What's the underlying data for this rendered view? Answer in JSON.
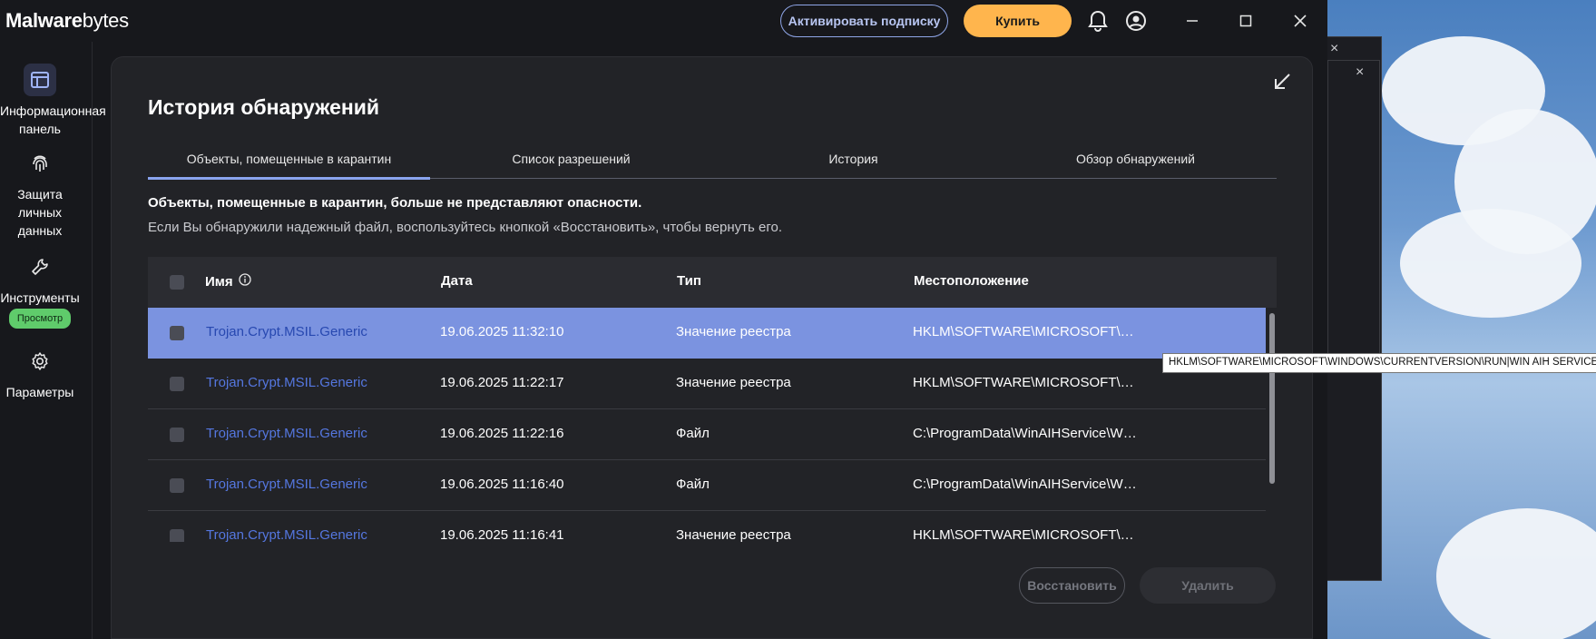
{
  "app": {
    "brand_bold": "Malware",
    "brand_thin": "bytes"
  },
  "titlebar": {
    "activate_label": "Активировать подписку",
    "buy_label": "Купить"
  },
  "sidebar": {
    "items": [
      {
        "label": "Информационная панель",
        "icon": "dashboard-icon"
      },
      {
        "label": "Защита личных данных",
        "icon": "fingerprint-icon"
      },
      {
        "label": "Инструменты",
        "icon": "wrench-icon",
        "badge": "Просмотр"
      },
      {
        "label": "Параметры",
        "icon": "gear-icon"
      }
    ]
  },
  "panel": {
    "title": "История обнаружений",
    "tabs": [
      "Объекты, помещенные в карантин",
      "Список разрешений",
      "История",
      "Обзор обнаружений"
    ],
    "info_bold": "Объекты, помещенные в карантин, больше не представляют опасности.",
    "info_text": "Если Вы обнаружили надежный файл, воспользуйтесь кнопкой «Восстановить», чтобы вернуть его.",
    "columns": {
      "name": "Имя",
      "date": "Дата",
      "type": "Тип",
      "location": "Местоположение"
    },
    "rows": [
      {
        "name": "Trojan.Crypt.MSIL.Generic",
        "date": "19.06.2025 11:32:10",
        "type": "Значение реестра",
        "location": "HKLM\\SOFTWARE\\MICROSOFT\\WIN..."
      },
      {
        "name": "Trojan.Crypt.MSIL.Generic",
        "date": "19.06.2025 11:22:17",
        "type": "Значение реестра",
        "location": "HKLM\\SOFTWARE\\MICROSOFT\\WIN..."
      },
      {
        "name": "Trojan.Crypt.MSIL.Generic",
        "date": "19.06.2025 11:22:16",
        "type": "Файл",
        "location": "C:\\ProgramData\\WinAIHService\\Win..."
      },
      {
        "name": "Trojan.Crypt.MSIL.Generic",
        "date": "19.06.2025 11:16:40",
        "type": "Файл",
        "location": "C:\\ProgramData\\WinAIHService\\Win..."
      },
      {
        "name": "Trojan.Crypt.MSIL.Generic",
        "date": "19.06.2025 11:16:41",
        "type": "Значение реестра",
        "location": "HKLM\\SOFTWARE\\MICROSOFT\\WIN..."
      }
    ],
    "restore_label": "Восстановить",
    "delete_label": "Удалить"
  },
  "tooltip": "HKLM\\SOFTWARE\\MICROSOFT\\WINDOWS\\CURRENTVERSION\\RUN|WIN AIH SERVICE",
  "colors": {
    "accent": "#8aa4ef",
    "buy": "#ffb54d",
    "selected_row": "#7b93e0",
    "link": "#5577e0"
  }
}
